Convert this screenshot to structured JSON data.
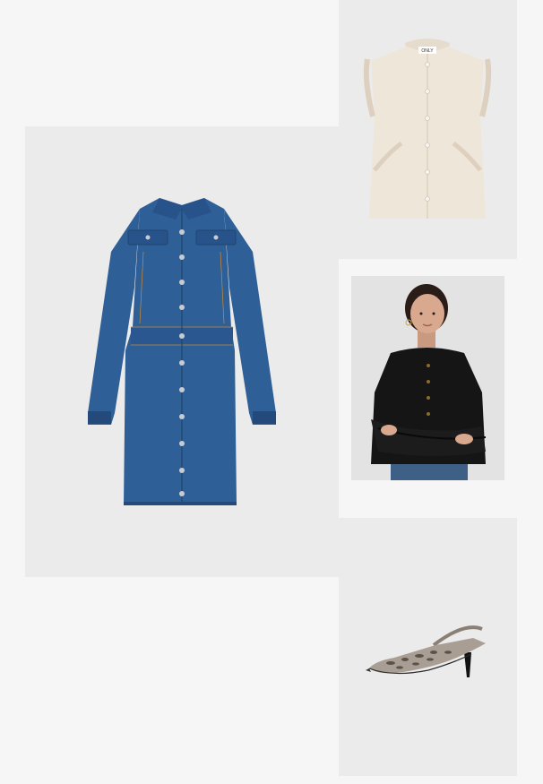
{
  "products": [
    {
      "id": "denim-dress",
      "alt": ""
    },
    {
      "id": "ruffle-vest",
      "alt": "",
      "tag_text": "ONLY"
    },
    {
      "id": "black-cardigan",
      "alt": ""
    },
    {
      "id": "snakeskin-slingback",
      "alt": ""
    }
  ],
  "colors": {
    "page_background": "#f6f6f6",
    "tile_background": "#ebebeb",
    "denim": "#2f5f97",
    "denim_dark": "#234a7a",
    "vest": "#efe6da",
    "cardigan": "#151515",
    "skin": "#d8a98f",
    "shoe_snake": "#a89e93"
  },
  "icons": [
    "denim-dress-image",
    "ruffle-vest-image",
    "model-cardigan-image",
    "slingback-shoe-image"
  ]
}
